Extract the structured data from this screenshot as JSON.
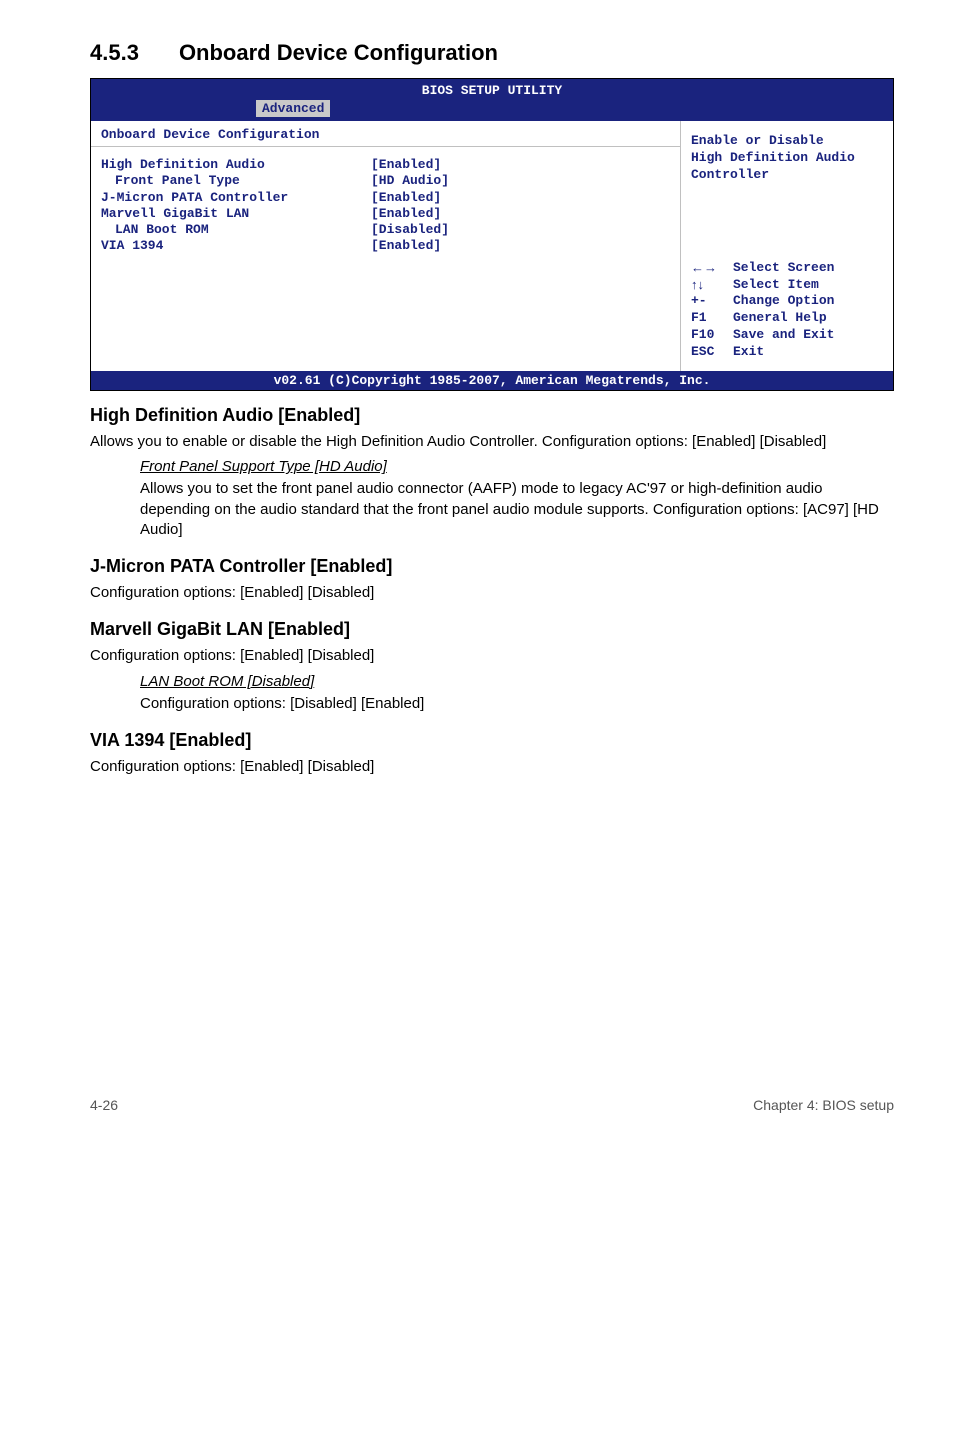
{
  "section": {
    "number": "4.5.3",
    "title": "Onboard Device Configuration"
  },
  "bios": {
    "utility_label": "BIOS SETUP UTILITY",
    "tab": "Advanced",
    "left_header": "Onboard Device Configuration",
    "items": [
      {
        "label": "High Definition Audio",
        "value": "[Enabled]",
        "indent": false
      },
      {
        "label": "Front Panel Type",
        "value": "[HD Audio]",
        "indent": true
      },
      {
        "label": "J-Micron PATA Controller",
        "value": "[Enabled]",
        "indent": false
      },
      {
        "label": "Marvell GigaBit LAN",
        "value": "[Enabled]",
        "indent": false
      },
      {
        "label": "LAN Boot ROM",
        "value": "[Disabled]",
        "indent": true
      },
      {
        "label": "VIA 1394",
        "value": "[Enabled]",
        "indent": false
      }
    ],
    "help": {
      "line1": "Enable or Disable",
      "line2": "High Definition Audio",
      "line3": "Controller"
    },
    "keys": [
      {
        "key": "←→",
        "desc": "Select Screen"
      },
      {
        "key": "↑↓",
        "desc": "Select Item"
      },
      {
        "key": "+-",
        "desc": "Change Option"
      },
      {
        "key": "F1",
        "desc": "General Help"
      },
      {
        "key": "F10",
        "desc": "Save and Exit"
      },
      {
        "key": "ESC",
        "desc": "Exit"
      }
    ],
    "footer": "v02.61 (C)Copyright 1985-2007, American Megatrends, Inc."
  },
  "content": {
    "hda": {
      "title": "High Definition Audio [Enabled]",
      "p1": "Allows you to enable or disable the High Definition Audio Controller. Configuration options: [Enabled] [Disabled]",
      "sub_title": "Front Panel Support Type [HD Audio]",
      "sub_body": "Allows you to set the front panel audio connector (AAFP) mode to legacy AC'97 or high-definition audio depending on the audio standard that the front panel audio module supports. Configuration options: [AC97] [HD Audio]"
    },
    "jmicron": {
      "title": "J-Micron PATA Controller [Enabled]",
      "p1": "Configuration options: [Enabled] [Disabled]"
    },
    "marvell": {
      "title": "Marvell GigaBit LAN [Enabled]",
      "p1": "Configuration options: [Enabled] [Disabled]",
      "sub_title": "LAN Boot ROM [Disabled]",
      "sub_body": "Configuration options: [Disabled] [Enabled]"
    },
    "via": {
      "title": "VIA 1394 [Enabled]",
      "p1": "Configuration options: [Enabled] [Disabled]"
    }
  },
  "footer": {
    "left": "4-26",
    "right": "Chapter 4: BIOS setup"
  }
}
